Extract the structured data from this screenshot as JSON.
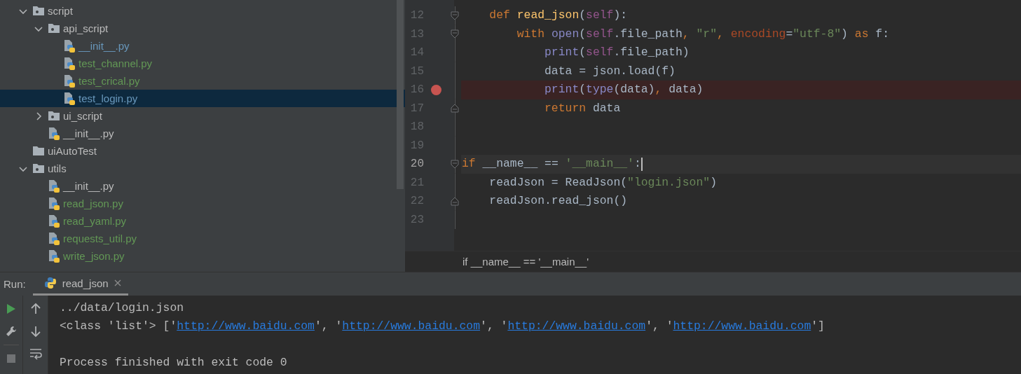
{
  "project_tree": [
    {
      "label": "script",
      "kind": "package",
      "expanded": true,
      "selected": false,
      "color": "#bbbbbb",
      "children": [
        {
          "label": "api_script",
          "kind": "package",
          "expanded": true,
          "selected": false,
          "color": "#bbbbbb",
          "children": [
            {
              "label": "__init__.py",
              "kind": "python",
              "selected": false,
              "color": "#6897bb"
            },
            {
              "label": "test_channel.py",
              "kind": "python",
              "selected": false,
              "color": "#629755"
            },
            {
              "label": "test_crical.py",
              "kind": "python",
              "selected": false,
              "color": "#629755"
            },
            {
              "label": "test_login.py",
              "kind": "python",
              "selected": true,
              "color": "#6897bb"
            }
          ]
        },
        {
          "label": "ui_script",
          "kind": "package",
          "expanded": false,
          "selected": false,
          "color": "#bbbbbb"
        },
        {
          "label": "__init__.py",
          "kind": "python",
          "selected": false,
          "color": "#bbbbbb"
        }
      ]
    },
    {
      "label": "uiAutoTest",
      "kind": "folder",
      "selected": false,
      "color": "#bbbbbb"
    },
    {
      "label": "utils",
      "kind": "package",
      "expanded": true,
      "selected": false,
      "color": "#bbbbbb",
      "children": [
        {
          "label": "__init__.py",
          "kind": "python",
          "selected": false,
          "color": "#bbbbbb"
        },
        {
          "label": "read_json.py",
          "kind": "python",
          "selected": false,
          "color": "#629755"
        },
        {
          "label": "read_yaml.py",
          "kind": "python",
          "selected": false,
          "color": "#629755"
        },
        {
          "label": "requests_util.py",
          "kind": "python",
          "selected": false,
          "color": "#629755"
        },
        {
          "label": "write_json.py",
          "kind": "python",
          "selected": false,
          "color": "#629755"
        }
      ]
    }
  ],
  "editor": {
    "lines": [
      {
        "number": "12",
        "fold_start": true,
        "fold_end": false,
        "breakpoint": false,
        "current": false,
        "caret": false,
        "tokens": [
          {
            "text": "    def ",
            "kind": "keyword"
          },
          {
            "text": "read_json",
            "kind": "function"
          },
          {
            "text": "(",
            "kind": "plain"
          },
          {
            "text": "self",
            "kind": "self"
          },
          {
            "text": "):",
            "kind": "plain"
          }
        ]
      },
      {
        "number": "13",
        "fold_start": true,
        "fold_end": false,
        "breakpoint": false,
        "current": false,
        "caret": false,
        "tokens": [
          {
            "text": "        with ",
            "kind": "keyword"
          },
          {
            "text": "open",
            "kind": "builtin"
          },
          {
            "text": "(",
            "kind": "plain"
          },
          {
            "text": "self",
            "kind": "self"
          },
          {
            "text": ".file_path",
            "kind": "plain"
          },
          {
            "text": ", ",
            "kind": "comma"
          },
          {
            "text": "\"r\"",
            "kind": "string"
          },
          {
            "text": ", ",
            "kind": "comma"
          },
          {
            "text": "encoding",
            "kind": "param"
          },
          {
            "text": "=",
            "kind": "plain"
          },
          {
            "text": "\"utf-8\"",
            "kind": "string"
          },
          {
            "text": ") ",
            "kind": "plain"
          },
          {
            "text": "as",
            "kind": "keyword"
          },
          {
            "text": " f:",
            "kind": "plain"
          }
        ]
      },
      {
        "number": "14",
        "fold_start": false,
        "fold_end": false,
        "breakpoint": false,
        "current": false,
        "caret": false,
        "tokens": [
          {
            "text": "            print",
            "kind": "builtin"
          },
          {
            "text": "(",
            "kind": "plain"
          },
          {
            "text": "self",
            "kind": "self"
          },
          {
            "text": ".file_path)",
            "kind": "plain"
          }
        ]
      },
      {
        "number": "15",
        "fold_start": false,
        "fold_end": false,
        "breakpoint": false,
        "current": false,
        "caret": false,
        "tokens": [
          {
            "text": "            data = json.load(f)",
            "kind": "plain"
          }
        ]
      },
      {
        "number": "16",
        "fold_start": false,
        "fold_end": false,
        "breakpoint": true,
        "current": false,
        "caret": false,
        "tokens": [
          {
            "text": "            print",
            "kind": "builtin"
          },
          {
            "text": "(",
            "kind": "plain"
          },
          {
            "text": "type",
            "kind": "builtin"
          },
          {
            "text": "(data)",
            "kind": "plain"
          },
          {
            "text": ", ",
            "kind": "comma"
          },
          {
            "text": "data)",
            "kind": "plain"
          }
        ]
      },
      {
        "number": "17",
        "fold_start": false,
        "fold_end": true,
        "breakpoint": false,
        "current": false,
        "caret": false,
        "tokens": [
          {
            "text": "            return",
            "kind": "keyword"
          },
          {
            "text": " data",
            "kind": "plain"
          }
        ]
      },
      {
        "number": "18",
        "fold_start": false,
        "fold_end": false,
        "breakpoint": false,
        "current": false,
        "caret": false
      },
      {
        "number": "19",
        "fold_start": false,
        "fold_end": false,
        "breakpoint": false,
        "current": false,
        "caret": false
      },
      {
        "number": "20",
        "fold_start": true,
        "fold_end": false,
        "breakpoint": false,
        "current": true,
        "caret": true,
        "tokens": [
          {
            "text": "if",
            "kind": "keyword"
          },
          {
            "text": " __name__ == ",
            "kind": "plain"
          },
          {
            "text": "'__main__'",
            "kind": "string"
          },
          {
            "text": ":",
            "kind": "plain"
          }
        ]
      },
      {
        "number": "21",
        "fold_start": false,
        "fold_end": false,
        "breakpoint": false,
        "current": false,
        "caret": false,
        "tokens": [
          {
            "text": "    readJson = ReadJson(",
            "kind": "plain"
          },
          {
            "text": "\"login.json\"",
            "kind": "string"
          },
          {
            "text": ")",
            "kind": "plain"
          }
        ]
      },
      {
        "number": "22",
        "fold_start": false,
        "fold_end": true,
        "breakpoint": false,
        "current": false,
        "caret": false,
        "tokens": [
          {
            "text": "    readJson.read_json()",
            "kind": "plain"
          }
        ]
      },
      {
        "number": "23",
        "fold_start": false,
        "fold_end": false,
        "breakpoint": false,
        "current": false,
        "caret": false
      }
    ],
    "breadcrumb": "if __name__ == '__main__'"
  },
  "run_panel": {
    "label": "Run:",
    "tabs": [
      {
        "label": "read_json",
        "selected": true
      }
    ],
    "toolbar_left": [
      {
        "kind": "run",
        "disabled": false
      },
      {
        "kind": "wrench",
        "disabled": false
      },
      {
        "kind": "stop",
        "disabled": true
      }
    ],
    "toolbar_right": [
      {
        "kind": "up",
        "disabled": false
      },
      {
        "kind": "down",
        "disabled": false
      },
      {
        "kind": "wrap",
        "disabled": false
      }
    ],
    "console": [
      {
        "segments": [
          {
            "text": "../data/login.json",
            "kind": "plain"
          }
        ]
      },
      {
        "segments": [
          {
            "text": "<class 'list'> ['",
            "kind": "plain"
          },
          {
            "text": "http://www.baidu.com",
            "kind": "link"
          },
          {
            "text": "', '",
            "kind": "plain"
          },
          {
            "text": "http://www.baidu.com",
            "kind": "link"
          },
          {
            "text": "', '",
            "kind": "plain"
          },
          {
            "text": "http://www.baidu.com",
            "kind": "link"
          },
          {
            "text": "', '",
            "kind": "plain"
          },
          {
            "text": "http://www.baidu.com",
            "kind": "link"
          },
          {
            "text": "']",
            "kind": "plain"
          }
        ]
      },
      {
        "spaced": true,
        "segments": [
          {
            "text": "Process finished with exit code 0",
            "kind": "plain"
          }
        ]
      }
    ]
  }
}
